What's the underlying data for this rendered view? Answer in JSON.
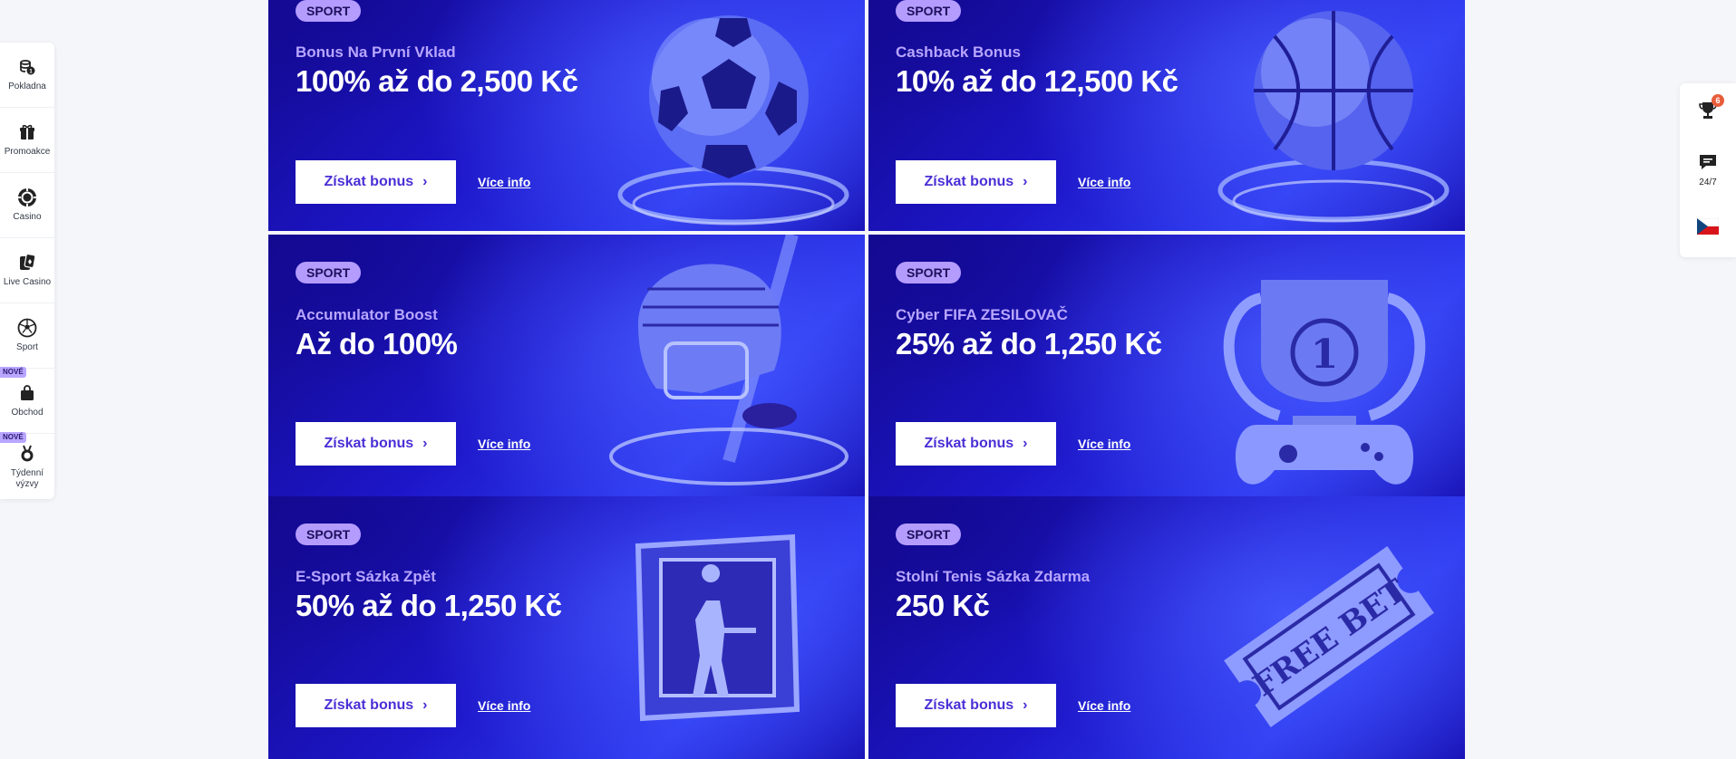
{
  "left_sidebar": {
    "items": [
      {
        "label": "Pokladna",
        "icon": "coins-icon"
      },
      {
        "label": "Promoakce",
        "icon": "gift-icon"
      },
      {
        "label": "Casino",
        "icon": "casino-chip-icon"
      },
      {
        "label": "Live Casino",
        "icon": "cards-icon"
      },
      {
        "label": "Sport",
        "icon": "soccer-ball-icon"
      },
      {
        "label": "Obchod",
        "icon": "shopping-bag-icon",
        "badge": "NOVÉ"
      },
      {
        "label": "Týdenní výzvy",
        "icon": "medal-icon",
        "badge": "NOVÉ"
      }
    ]
  },
  "right_sidebar": {
    "trophy_count": "6",
    "chat_label": "24/7",
    "language": "cs"
  },
  "cards": [
    {
      "tag": "SPORT",
      "subtitle": "Bonus Na První Vklad",
      "headline": "100% až do 2,500 Kč",
      "cta": "Získat bonus",
      "more": "Více info",
      "art": "soccer-ball"
    },
    {
      "tag": "SPORT",
      "subtitle": "Cashback Bonus",
      "headline": "10% až do 12,500 Kč",
      "cta": "Získat bonus",
      "more": "Více info",
      "art": "basketball"
    },
    {
      "tag": "SPORT",
      "subtitle": "Accumulator Boost",
      "headline": "Až do 100%",
      "cta": "Získat bonus",
      "more": "Více info",
      "art": "hockey-helmet"
    },
    {
      "tag": "SPORT",
      "subtitle": "Cyber FIFA ZESILOVAČ",
      "headline": "25% až do 1,250 Kč",
      "cta": "Získat bonus",
      "more": "Více info",
      "art": "trophy-gamepad"
    },
    {
      "tag": "SPORT",
      "subtitle": "E-Sport Sázka Zpět",
      "headline": "50% až do 1,250 Kč",
      "cta": "Získat bonus",
      "more": "Více info",
      "art": "esport-soldier"
    },
    {
      "tag": "SPORT",
      "subtitle": "Stolní Tenis Sázka Zdarma",
      "headline": "250 Kč",
      "cta": "Získat bonus",
      "more": "Více info",
      "art": "free-bet-ticket"
    }
  ],
  "colors": {
    "card_bg_dark": "#12088a",
    "card_bg_light": "#2e3af0",
    "tag_bg": "#b49cff",
    "subtitle": "#b8a6ff",
    "cta_text": "#4a2fd6",
    "badge_bg": "#e85d3a"
  }
}
